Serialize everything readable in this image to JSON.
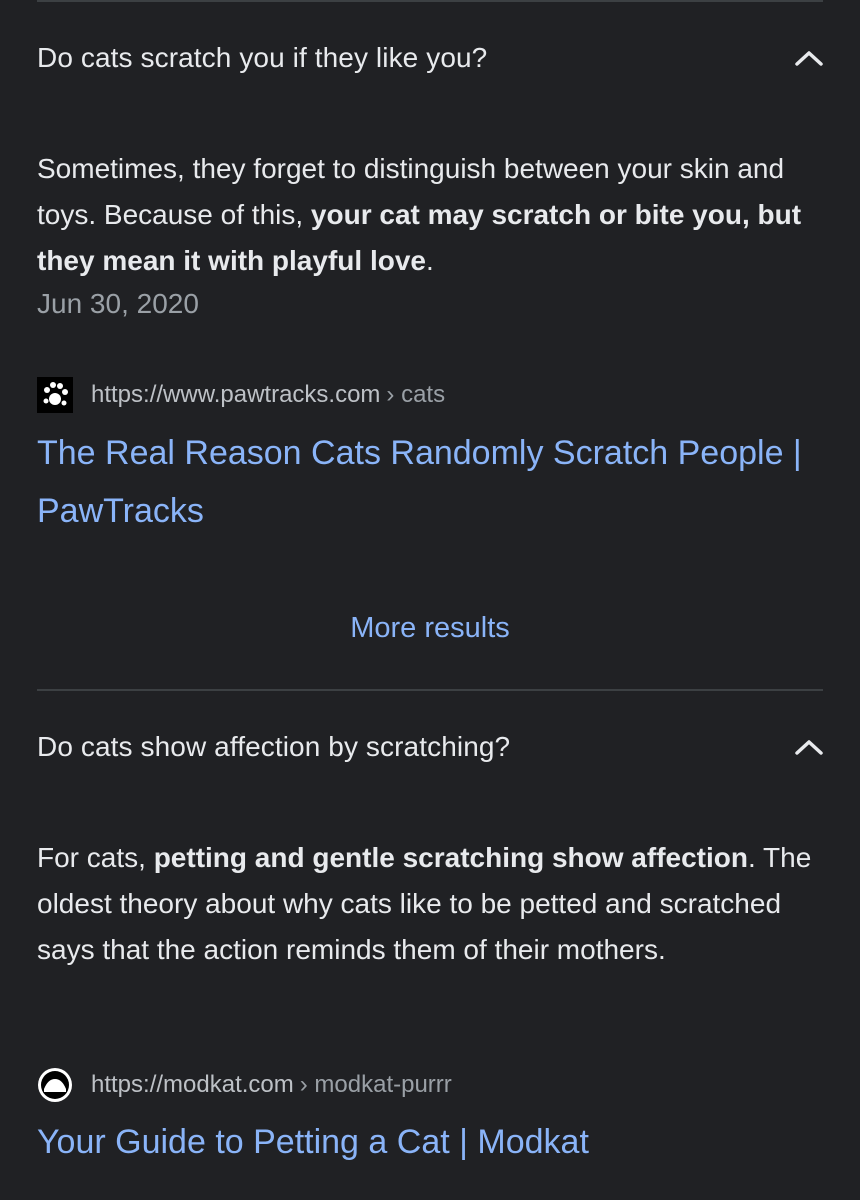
{
  "faq1": {
    "question": "Do cats scratch you if they like you?",
    "answer_part1": "Sometimes, they forget to distinguish between your skin and toys. Because of this, ",
    "answer_bold": "your cat may scratch or bite you, but they mean it with playful love",
    "answer_part2": ".",
    "date": "Jun 30, 2020",
    "source_url": "https://www.pawtracks.com",
    "source_crumb": "› cats",
    "result_title": "The Real Reason Cats Randomly Scratch People | PawTracks",
    "favicon": "paw-icon"
  },
  "more_results": "More results",
  "faq2": {
    "question": "Do cats show affection by scratching?",
    "answer_part1": "For cats, ",
    "answer_bold": "petting and gentle scratching show affection",
    "answer_part2": ". The oldest theory about why cats like to be petted and scratched says that the action reminds them of their mothers.",
    "source_url": "https://modkat.com",
    "source_crumb": "› modkat-purrr",
    "result_title": "Your Guide to Petting a Cat | Modkat",
    "favicon": "modkat-icon"
  },
  "colors": {
    "background": "#202124",
    "text": "#e8eaed",
    "muted": "#9aa0a6",
    "link": "#8ab4f8",
    "divider": "#3c4043"
  }
}
